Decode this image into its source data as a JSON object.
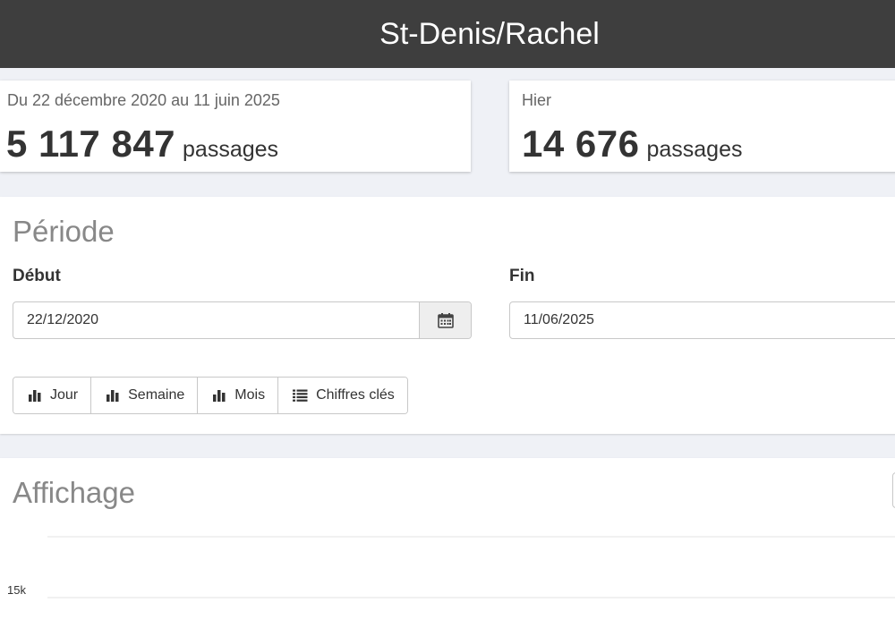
{
  "header": {
    "title": "St-Denis/Rachel"
  },
  "summary": {
    "range_text": "Du 22 décembre 2020 au 11 juin 2025",
    "total_count": "5 117 847",
    "total_unit": "passages",
    "yesterday_label": "Hier",
    "yesterday_count": "14 676",
    "yesterday_unit": "passages"
  },
  "periode": {
    "title": "Période",
    "start_label": "Début",
    "start_value": "22/12/2020",
    "end_label": "Fin",
    "end_value": "11/06/2025",
    "buttons": [
      {
        "label": "Jour",
        "icon": "bar-chart-icon"
      },
      {
        "label": "Semaine",
        "icon": "bar-chart-icon"
      },
      {
        "label": "Mois",
        "icon": "bar-chart-icon"
      },
      {
        "label": "Chiffres clés",
        "icon": "list-icon"
      }
    ]
  },
  "affichage": {
    "title": "Affichage"
  },
  "chart_data": {
    "type": "bar",
    "title": "",
    "xlabel": "",
    "ylabel": "",
    "y_tick_labels": [
      "15k"
    ],
    "y_ticks": [
      15000
    ],
    "grid": true,
    "series": []
  },
  "colors": {
    "header_bg": "#3e3e3e",
    "page_bg": "#eff1f6",
    "panel_title": "#888888"
  }
}
